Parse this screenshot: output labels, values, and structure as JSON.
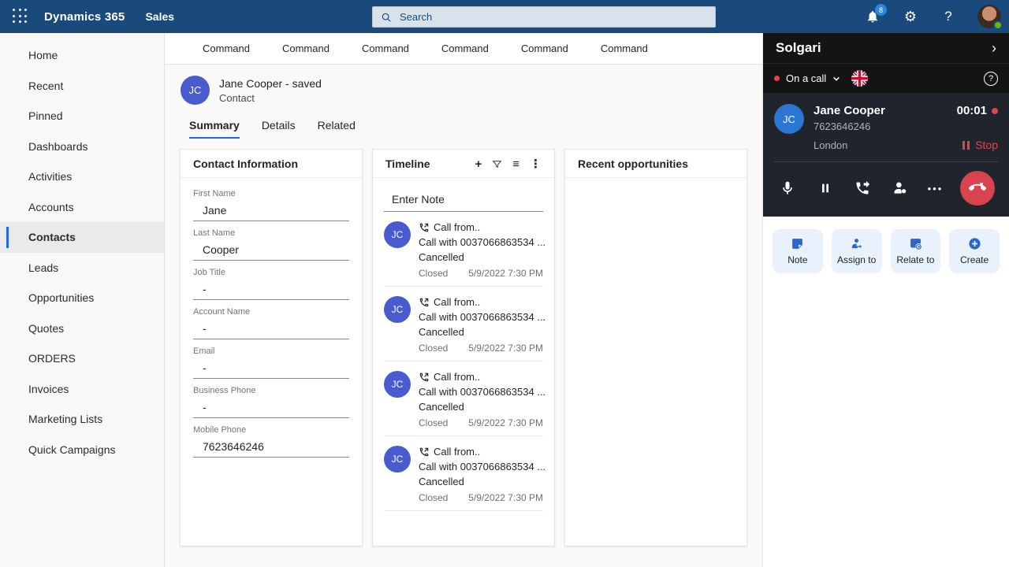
{
  "top_bar": {
    "app_title": "Dynamics 365",
    "app_area": "Sales",
    "search_placeholder": "Search",
    "notification_count": "8",
    "help_label": "?"
  },
  "sidebar": {
    "items": [
      {
        "label": "Home",
        "active": false
      },
      {
        "label": "Recent",
        "active": false
      },
      {
        "label": "Pinned",
        "active": false
      },
      {
        "label": "Dashboards",
        "active": false
      },
      {
        "label": "Activities",
        "active": false
      },
      {
        "label": "Accounts",
        "active": false
      },
      {
        "label": "Contacts",
        "active": true
      },
      {
        "label": "Leads",
        "active": false
      },
      {
        "label": "Opportunities",
        "active": false
      },
      {
        "label": "Quotes",
        "active": false
      },
      {
        "label": "ORDERS",
        "active": false
      },
      {
        "label": "Invoices",
        "active": false
      },
      {
        "label": "Marketing Lists",
        "active": false
      },
      {
        "label": "Quick Campaigns",
        "active": false
      }
    ]
  },
  "command_bar": {
    "commands": [
      "Command",
      "Command",
      "Command",
      "Command",
      "Command",
      "Command"
    ]
  },
  "record_header": {
    "avatar_initials": "JC",
    "title": "Jane Cooper - saved",
    "subtitle": "Contact"
  },
  "tabs": [
    {
      "label": "Summary",
      "active": true
    },
    {
      "label": "Details",
      "active": false
    },
    {
      "label": "Related",
      "active": false
    }
  ],
  "contact_info": {
    "title": "Contact Information",
    "fields": [
      {
        "label": "First Name",
        "value": "Jane"
      },
      {
        "label": "Last Name",
        "value": "Cooper"
      },
      {
        "label": "Job Title",
        "value": "-"
      },
      {
        "label": "Account Name",
        "value": "-"
      },
      {
        "label": "Email",
        "value": "-"
      },
      {
        "label": "Business Phone",
        "value": "-"
      },
      {
        "label": "Mobile Phone",
        "value": "7623646246"
      }
    ]
  },
  "timeline": {
    "title": "Timeline",
    "note_placeholder": "Enter Note",
    "entries": [
      {
        "avatar": "JC",
        "line1": "Call from..",
        "line2": "Call with 0037066863534 ...",
        "line3": "Cancelled",
        "status": "Closed",
        "date": "5/9/2022 7:30 PM"
      },
      {
        "avatar": "JC",
        "line1": "Call from..",
        "line2": "Call with 0037066863534 ...",
        "line3": "Cancelled",
        "status": "Closed",
        "date": "5/9/2022 7:30 PM"
      },
      {
        "avatar": "JC",
        "line1": "Call from..",
        "line2": "Call with 0037066863534 ...",
        "line3": "Cancelled",
        "status": "Closed",
        "date": "5/9/2022 7:30 PM"
      },
      {
        "avatar": "JC",
        "line1": "Call from..",
        "line2": "Call with 0037066863534 ...",
        "line3": "Cancelled",
        "status": "Closed",
        "date": "5/9/2022 7:30 PM"
      }
    ]
  },
  "opportunities": {
    "title": "Recent opportunities"
  },
  "solgari": {
    "title": "Solgari",
    "status_label": "On a call",
    "call": {
      "initials": "JC",
      "name": "Jane Cooper",
      "timer": "00:01",
      "phone": "7623646246",
      "location": "London",
      "stop_label": "Stop"
    },
    "actions": [
      {
        "label": "Note"
      },
      {
        "label": "Assign to"
      },
      {
        "label": "Relate to"
      },
      {
        "label": "Create"
      }
    ]
  },
  "colors": {
    "topbar": "#1a4a7c",
    "accent": "#2266e3",
    "avatar_indigo": "#4a5acf",
    "avatar_blue": "#2b76d2",
    "danger_red": "#e0454e",
    "action_bg": "#e9f1fd",
    "action_icon": "#2b66c9",
    "panel_dark": "#141414",
    "call_card_dark": "#20242d"
  }
}
